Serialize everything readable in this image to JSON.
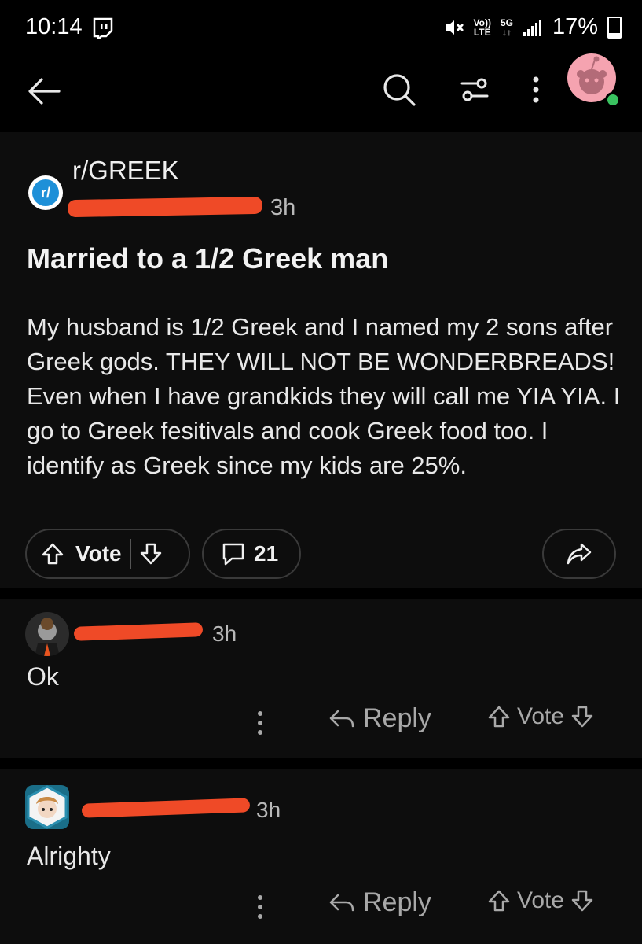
{
  "status": {
    "time": "10:14",
    "volte_top": "Vo))",
    "volte_bottom": "LTE",
    "net_top": "5G",
    "net_bottom": "↓↑",
    "battery": "17%"
  },
  "post": {
    "subreddit": "r/GREEK",
    "subreddit_icon_text": "r/",
    "age": "3h",
    "title": "Married to a 1/2 Greek man",
    "body": "My husband is 1/2 Greek and I named my 2 sons after Greek gods. THEY WILL NOT BE WONDERBREADS! Even when I have grandkids they will call me YIA YIA. I go to Greek fesitivals and cook Greek food too. I identify as Greek since my kids are 25%.",
    "vote_label": "Vote",
    "comment_count": "21"
  },
  "comments": [
    {
      "age": "3h",
      "text": "Ok",
      "reply_label": "Reply",
      "vote_label": "Vote"
    },
    {
      "age": "3h",
      "text": "Alrighty",
      "reply_label": "Reply",
      "vote_label": "Vote"
    }
  ],
  "colors": {
    "redaction": "#ef4a27",
    "avatar_pink": "#f5a3b0",
    "subreddit_blue": "#1e90d8",
    "online_green": "#3ac260"
  }
}
